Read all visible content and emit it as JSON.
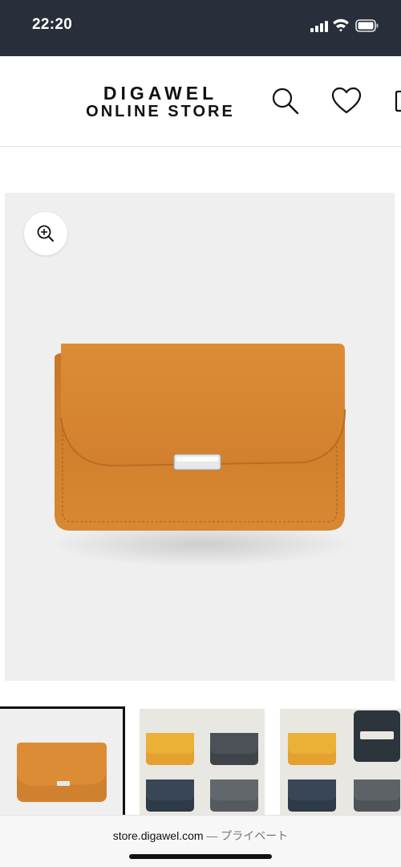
{
  "status_bar": {
    "time": "22:20",
    "icons": [
      "signal-icon",
      "wifi-icon",
      "battery-icon"
    ]
  },
  "header": {
    "logo_line1": "DIGAWEL",
    "logo_line2": "ONLINE STORE",
    "icons": [
      "search-icon",
      "heart-icon",
      "cart-icon"
    ]
  },
  "product": {
    "main_image": "leather-card-case-camel",
    "zoom_icon": "zoom-in-icon",
    "wallet_color": "#d4822f",
    "background_color": "#efefef"
  },
  "thumbnails": [
    {
      "name": "camel-front",
      "selected": true
    },
    {
      "name": "color-variants-4",
      "selected": false
    },
    {
      "name": "color-variants-open",
      "selected": false
    }
  ],
  "url_bar": {
    "host": "store.digawel.com",
    "separator": "—",
    "mode": "プライベート"
  }
}
